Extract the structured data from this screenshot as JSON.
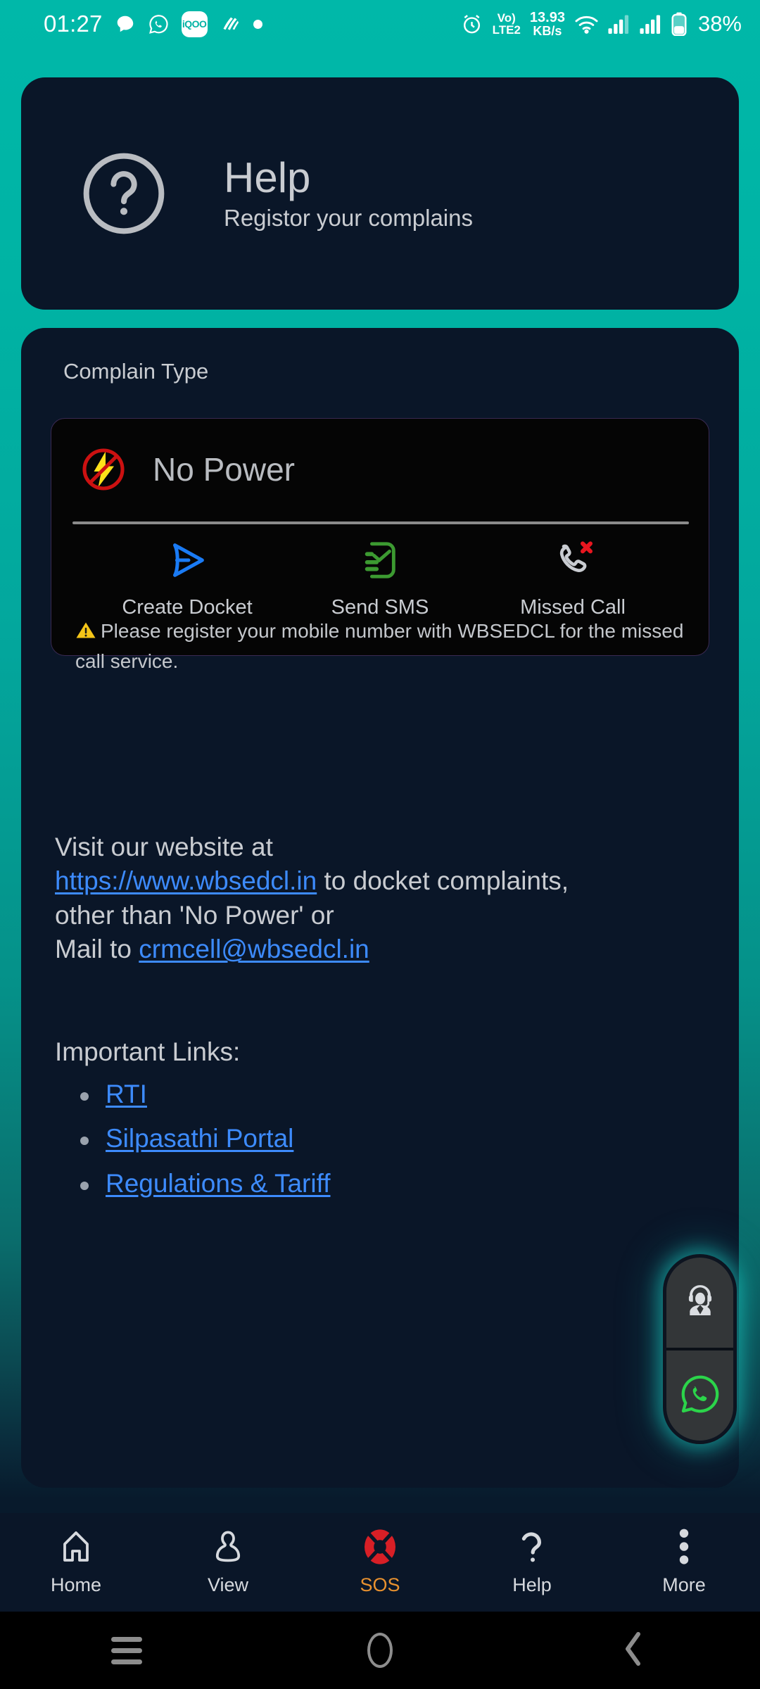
{
  "status_bar": {
    "time": "01:27",
    "app_icons": [
      "chat-bubble-icon",
      "whatsapp-icon",
      "iqoo-icon",
      "swiggy-icon",
      "dot-icon"
    ],
    "iqoo_label": "iQOO",
    "alarm_icon": "alarm-clock-icon",
    "network_line1": "Vo)",
    "network_line2": "LTE2",
    "data_speed_value": "13.93",
    "data_speed_unit": "KB/s",
    "wifi_icon": "wifi-icon",
    "signal_icon_1": "signal-bars-icon",
    "signal_icon_2": "signal-bars-icon",
    "battery_icon": "battery-icon",
    "battery_percent": "38%"
  },
  "header": {
    "icon": "question-mark-circle-icon",
    "title": "Help",
    "subtitle": "Registor your complains"
  },
  "main": {
    "section_label": "Complain Type",
    "complaint": {
      "icon": "no-power-bolt-icon",
      "title": "No Power",
      "actions": [
        {
          "icon": "send-docket-icon",
          "label": "Create Docket"
        },
        {
          "icon": "sms-check-icon",
          "label": "Send SMS"
        },
        {
          "icon": "missed-call-icon",
          "label": "Missed Call"
        }
      ],
      "note_icon": "warning-triangle-icon",
      "note": "Please register your mobile number with WBSEDCL for the missed call service."
    },
    "visit": {
      "line1": "Visit our website at",
      "website_link": "https://www.wbsedcl.in",
      "after_link": " to docket complaints,",
      "line3": "other than 'No Power' or",
      "mail_prefix": "Mail to ",
      "mail_link": "crmcell@wbsedcl.in"
    },
    "important_links_title": "Important Links:",
    "important_links": [
      "RTI",
      "Silpasathi Portal",
      "Regulations & Tariff"
    ]
  },
  "fab": {
    "support_icon": "support-agent-icon",
    "whatsapp_icon": "whatsapp-icon"
  },
  "bottom_nav": [
    {
      "icon": "home-icon",
      "label": "Home",
      "active": false
    },
    {
      "icon": "person-icon",
      "label": "View",
      "active": false
    },
    {
      "icon": "sos-lifebuoy-icon",
      "label": "SOS",
      "active": true
    },
    {
      "icon": "question-mark-icon",
      "label": "Help",
      "active": false
    },
    {
      "icon": "more-vertical-icon",
      "label": "More",
      "active": false
    }
  ],
  "android_nav": [
    {
      "icon": "recent-apps-icon"
    },
    {
      "icon": "home-circle-icon"
    },
    {
      "icon": "back-chevron-icon"
    }
  ],
  "colors": {
    "bg_teal": "#00b3a4",
    "card_navy": "#0a1628",
    "complaint_card_bg": "#050505",
    "link_blue": "#3d8bfd",
    "sos_orange": "#e8912f",
    "sos_red": "#d81f26",
    "whatsapp_green": "#25d366",
    "warning_yellow": "#f5c518"
  }
}
